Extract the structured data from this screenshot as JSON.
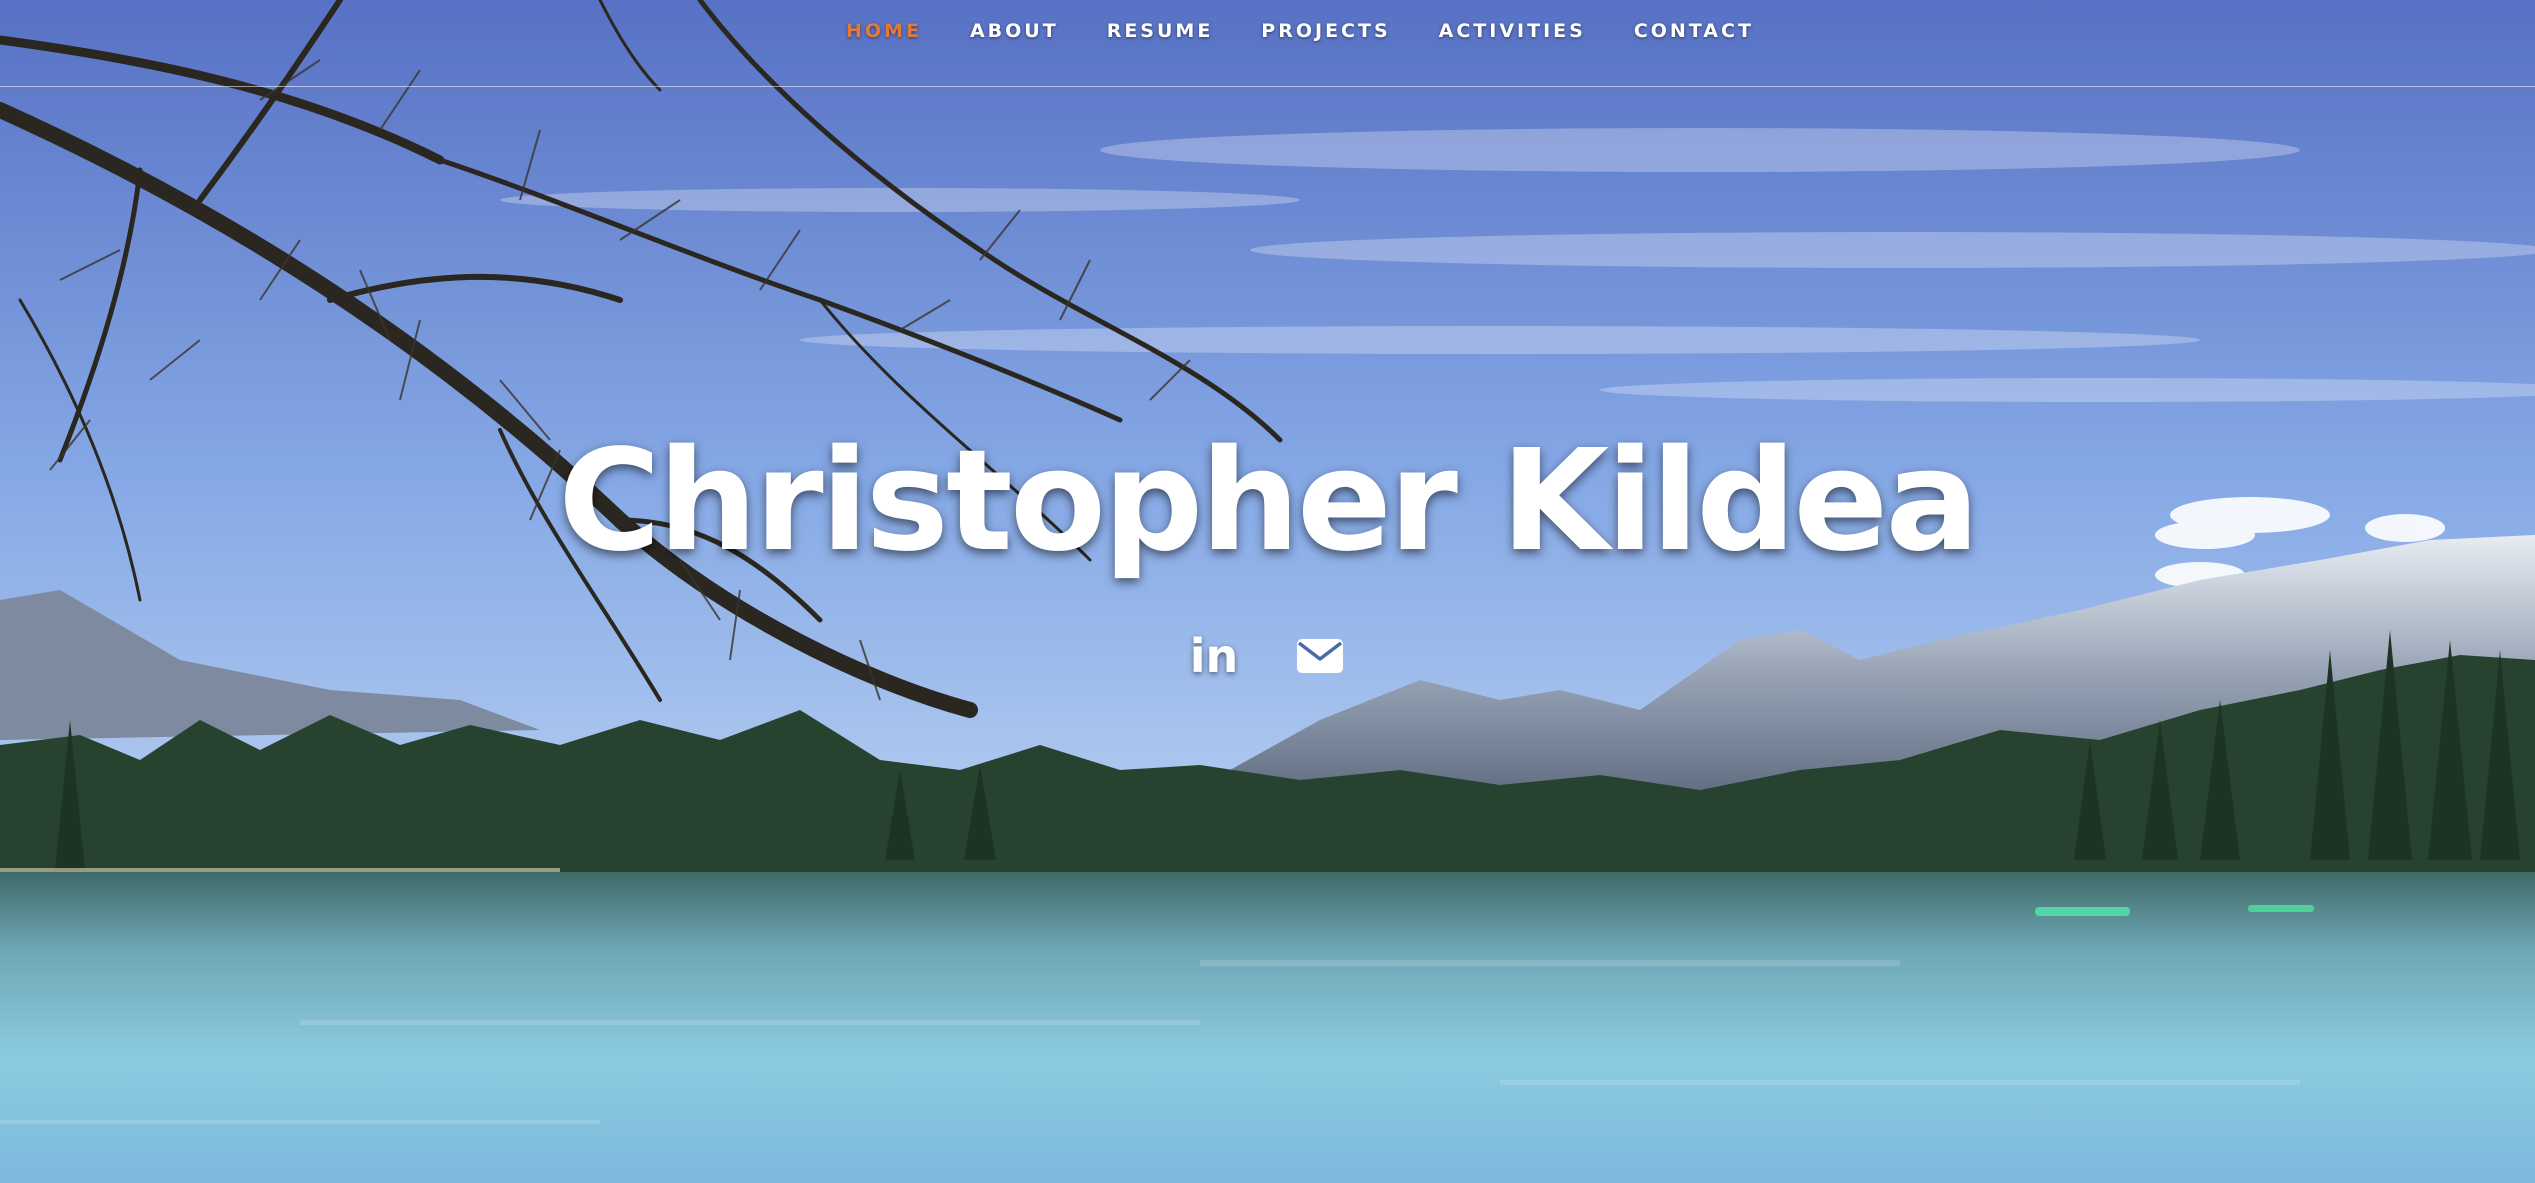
{
  "nav": {
    "items": [
      {
        "label": "HOME",
        "active": true
      },
      {
        "label": "ABOUT",
        "active": false
      },
      {
        "label": "RESUME",
        "active": false
      },
      {
        "label": "PROJECTS",
        "active": false
      },
      {
        "label": "ACTIVITIES",
        "active": false
      },
      {
        "label": "CONTACT",
        "active": false
      }
    ],
    "active_color": "#e07a3f"
  },
  "hero": {
    "title": "Christopher Kildea",
    "socials": [
      {
        "icon": "linkedin-icon",
        "text": "in"
      },
      {
        "icon": "envelope-icon"
      }
    ]
  },
  "colors": {
    "sky_top": "#5a79c9",
    "sky_bottom": "#a9c6ee",
    "water": "#7fc3da",
    "forest": "#24402e"
  }
}
